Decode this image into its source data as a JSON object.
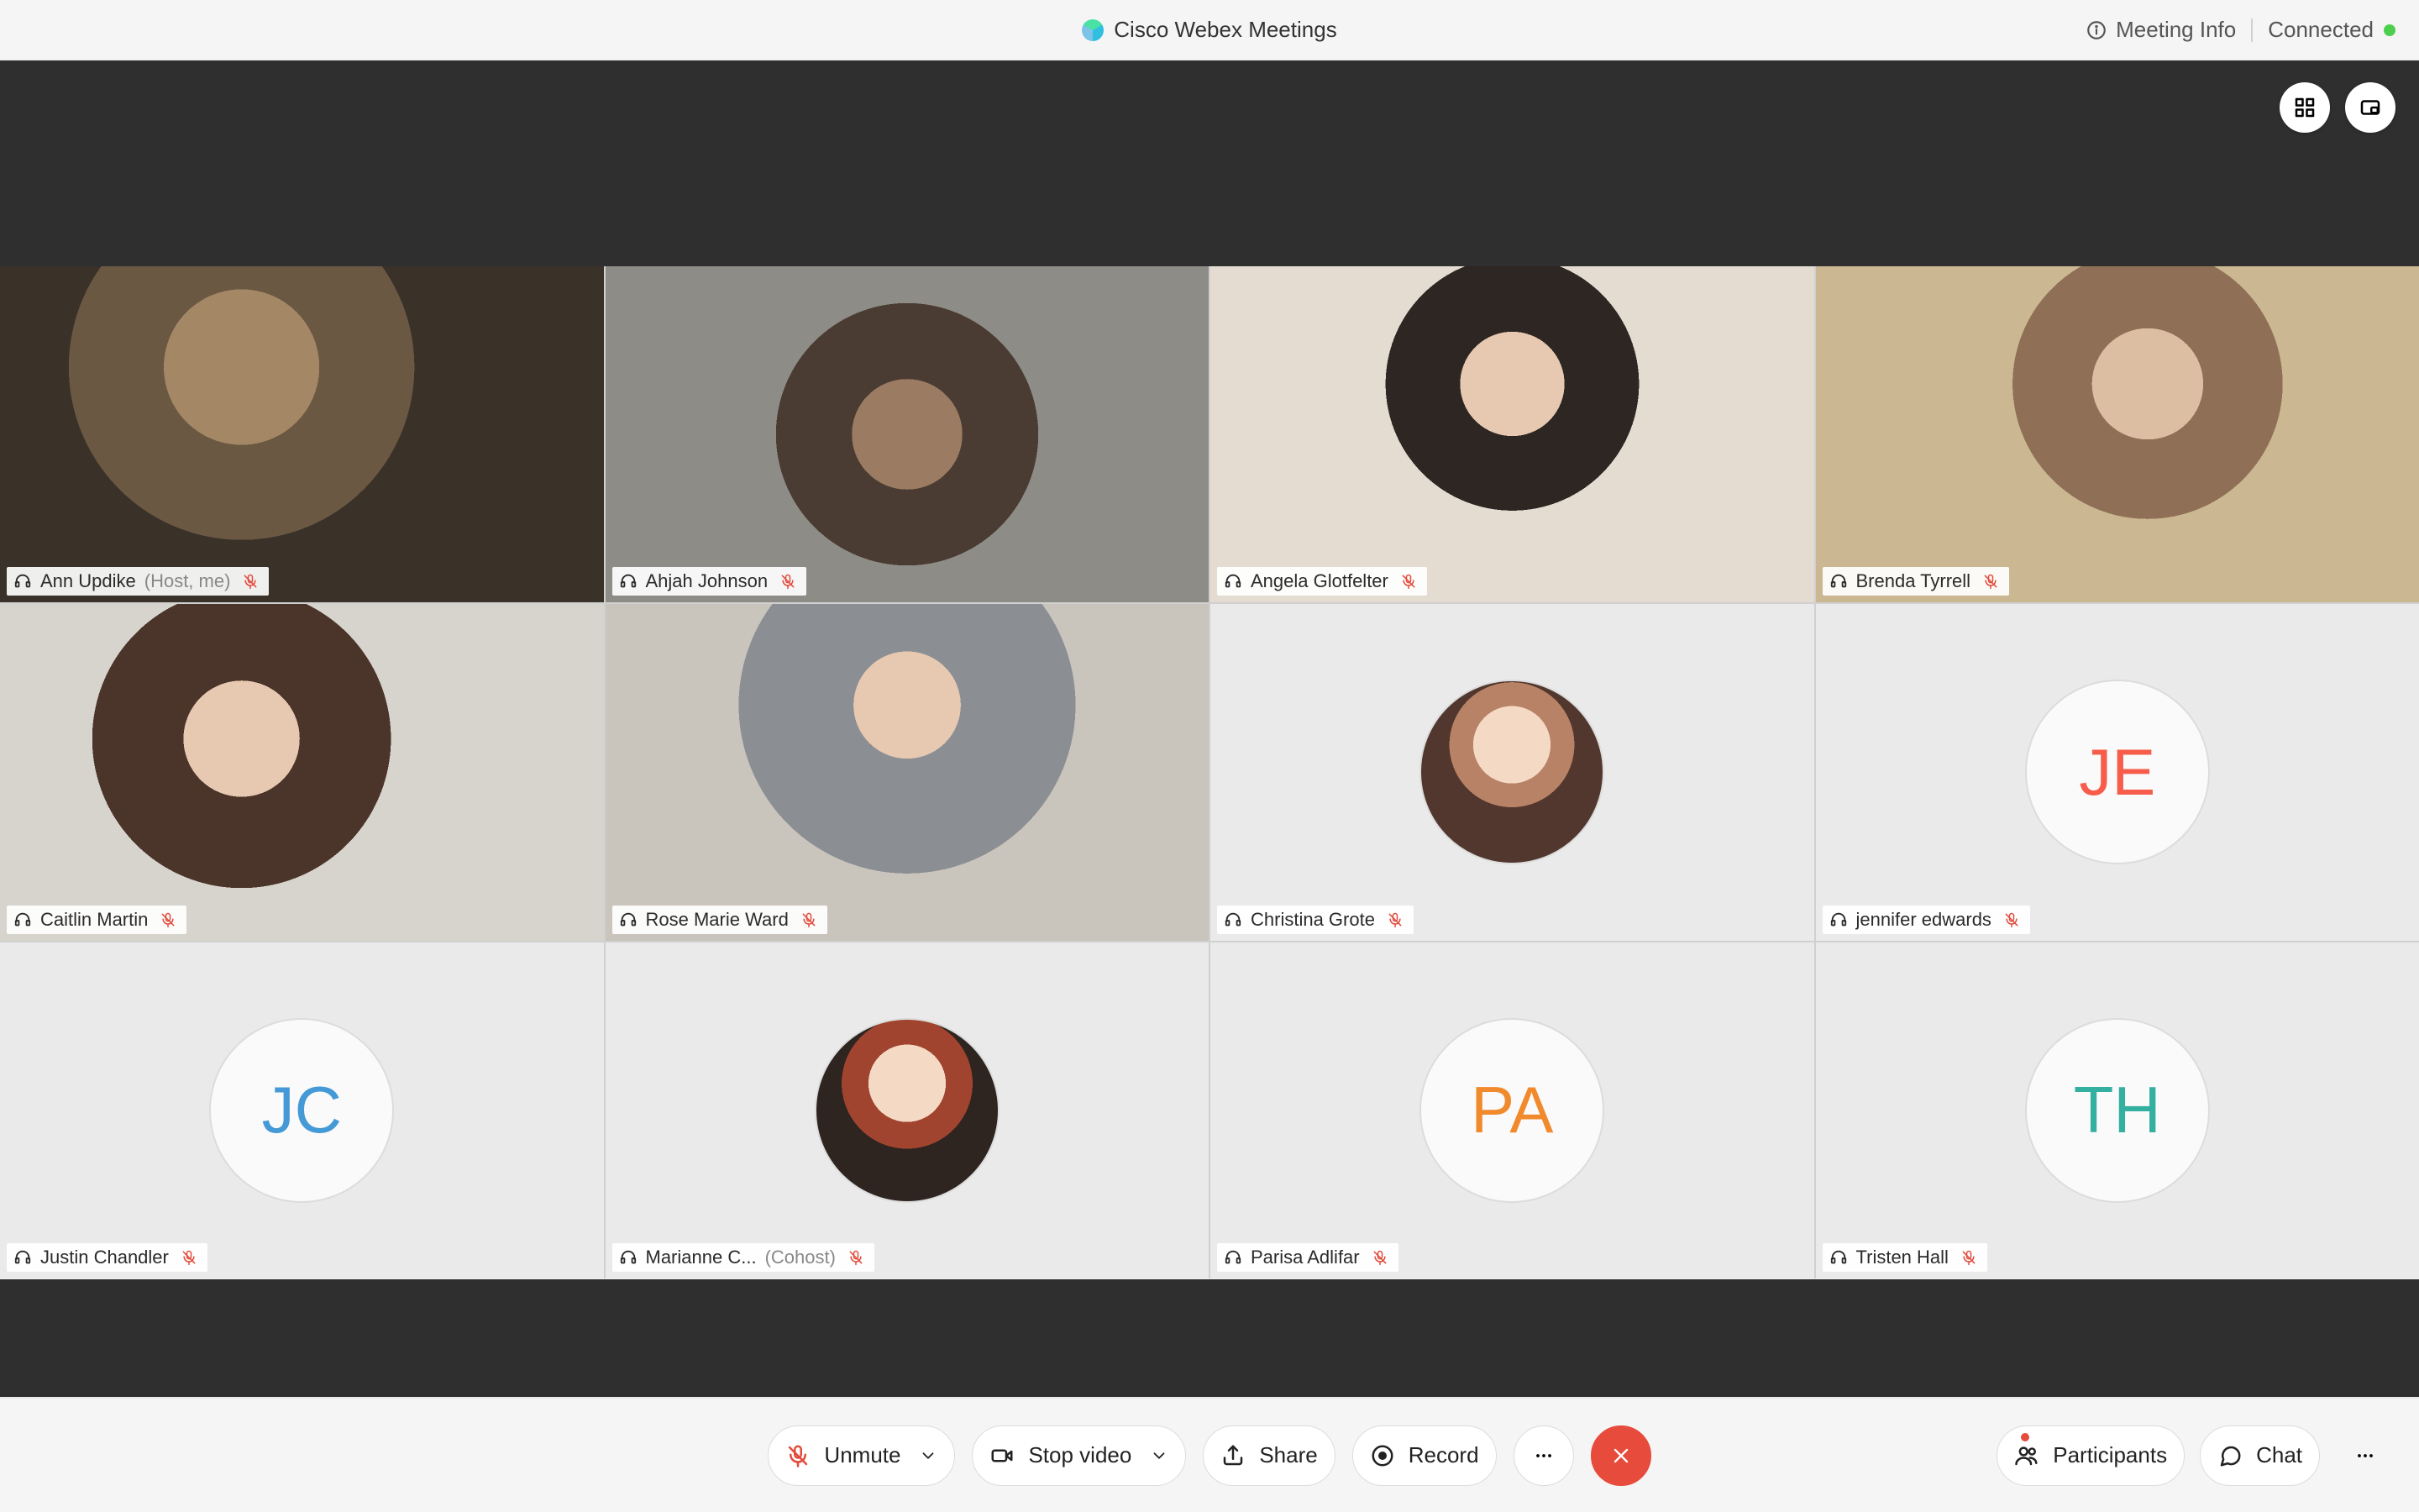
{
  "app": {
    "title": "Cisco Webex Meetings",
    "meeting_info_label": "Meeting Info",
    "connected_label": "Connected"
  },
  "participants": [
    {
      "name": "Ann Updike",
      "role": "(Host, me)",
      "muted": true,
      "video_on": true
    },
    {
      "name": "Ahjah Johnson",
      "role": "",
      "muted": true,
      "video_on": true
    },
    {
      "name": "Angela Glotfelter",
      "role": "",
      "muted": true,
      "video_on": true
    },
    {
      "name": "Brenda Tyrrell",
      "role": "",
      "muted": true,
      "video_on": true
    },
    {
      "name": "Caitlin Martin",
      "role": "",
      "muted": true,
      "video_on": true
    },
    {
      "name": "Rose Marie Ward",
      "role": "",
      "muted": true,
      "video_on": true
    },
    {
      "name": "Christina Grote",
      "role": "",
      "muted": true,
      "video_on": false,
      "avatar_type": "photo"
    },
    {
      "name": "jennifer edwards",
      "role": "",
      "muted": true,
      "video_on": false,
      "avatar_type": "initials",
      "initials": "JE",
      "avatar_class": "avatar-JE"
    },
    {
      "name": "Justin Chandler",
      "role": "",
      "muted": true,
      "video_on": false,
      "avatar_type": "initials",
      "initials": "JC",
      "avatar_class": "avatar-JC"
    },
    {
      "name": "Marianne C...",
      "role": "(Cohost)",
      "muted": true,
      "video_on": false,
      "avatar_type": "photo"
    },
    {
      "name": "Parisa Adlifar",
      "role": "",
      "muted": true,
      "video_on": false,
      "avatar_type": "initials",
      "initials": "PA",
      "avatar_class": "avatar-PA"
    },
    {
      "name": "Tristen Hall",
      "role": "",
      "muted": true,
      "video_on": false,
      "avatar_type": "initials",
      "initials": "TH",
      "avatar_class": "avatar-TH"
    }
  ],
  "controls": {
    "unmute": "Unmute",
    "stop_video": "Stop video",
    "share": "Share",
    "record": "Record",
    "participants": "Participants",
    "chat": "Chat"
  }
}
